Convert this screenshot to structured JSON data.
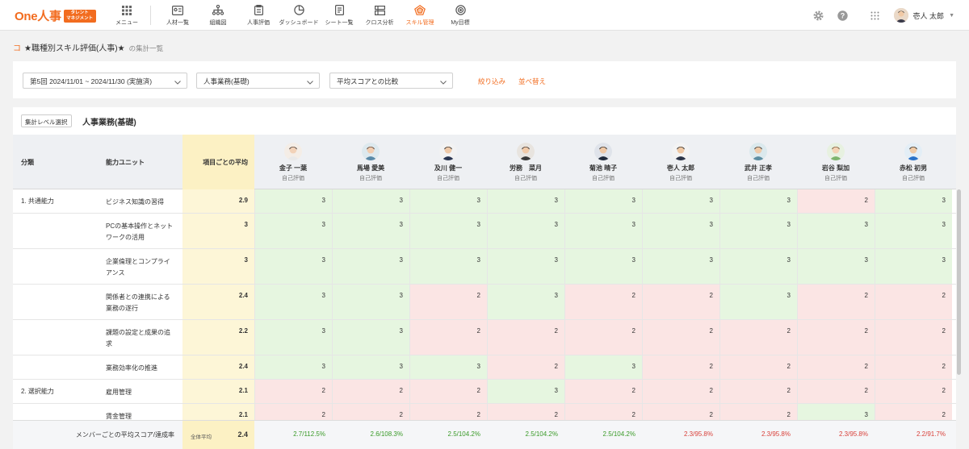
{
  "brand": {
    "logo": "One人事",
    "badge_line1": "タレント",
    "badge_line2": "マネジメント"
  },
  "nav": [
    {
      "label": "メニュー",
      "icon": "grid-menu-icon"
    },
    {
      "label": "人材一覧",
      "icon": "person-card-icon"
    },
    {
      "label": "組織図",
      "icon": "org-chart-icon"
    },
    {
      "label": "人事評価",
      "icon": "clipboard-icon"
    },
    {
      "label": "ダッシュボード",
      "icon": "pie-chart-icon"
    },
    {
      "label": "シート一覧",
      "icon": "document-icon"
    },
    {
      "label": "クロス分析",
      "icon": "cross-analysis-icon"
    },
    {
      "label": "スキル管理",
      "icon": "skill-radar-icon",
      "active": true
    },
    {
      "label": "My目標",
      "icon": "target-icon"
    }
  ],
  "user": {
    "name": "壱人 太郎"
  },
  "breadcrumb": {
    "back": "コ",
    "title": "★職種別スキル評価(人事)★",
    "sub": "の集計一覧"
  },
  "filters": {
    "period": "第5回 2024/11/01 ~ 2024/11/30 (実施済)",
    "job": "人事業務(基礎)",
    "compare": "平均スコアとの比較",
    "filter_link": "絞り込み",
    "sort_link": "並べ替え"
  },
  "level": {
    "button": "集計レベル選択",
    "name": "人事業務(基礎)"
  },
  "table": {
    "col_category": "分類",
    "col_unit": "能力ユニット",
    "col_avg": "項目ごとの平均",
    "members": [
      {
        "name": "金子 一葉",
        "type": "自己評価"
      },
      {
        "name": "馬場 愛美",
        "type": "自己評価"
      },
      {
        "name": "及川 健一",
        "type": "自己評価"
      },
      {
        "name": "労務　菜月",
        "type": "自己評価"
      },
      {
        "name": "菊池 晴子",
        "type": "自己評価"
      },
      {
        "name": "壱人 太郎",
        "type": "自己評価"
      },
      {
        "name": "武井 正孝",
        "type": "自己評価"
      },
      {
        "name": "岩谷 梨加",
        "type": "自己評価"
      },
      {
        "name": "赤松 初男",
        "type": "自己評価"
      }
    ],
    "rows": [
      {
        "category": "1. 共通能力",
        "unit": "ビジネス知識の習得",
        "avg": "2.9",
        "scores": [
          "3",
          "3",
          "3",
          "3",
          "3",
          "3",
          "3",
          "2",
          "3"
        ]
      },
      {
        "category": "",
        "unit": "PCの基本操作とネットワークの活用",
        "avg": "3",
        "scores": [
          "3",
          "3",
          "3",
          "3",
          "3",
          "3",
          "3",
          "3",
          "3"
        ]
      },
      {
        "category": "",
        "unit": "企業倫理とコンプライアンス",
        "avg": "3",
        "scores": [
          "3",
          "3",
          "3",
          "3",
          "3",
          "3",
          "3",
          "3",
          "3"
        ]
      },
      {
        "category": "",
        "unit": "関係者との連携による業務の遂行",
        "avg": "2.4",
        "scores": [
          "3",
          "3",
          "2",
          "3",
          "2",
          "2",
          "3",
          "2",
          "2"
        ]
      },
      {
        "category": "",
        "unit": "課題の設定と成果の追求",
        "avg": "2.2",
        "scores": [
          "3",
          "3",
          "2",
          "2",
          "2",
          "2",
          "2",
          "2",
          "2"
        ]
      },
      {
        "category": "",
        "unit": "業務効率化の推進",
        "avg": "2.4",
        "scores": [
          "3",
          "3",
          "3",
          "2",
          "3",
          "2",
          "2",
          "2",
          "2"
        ]
      },
      {
        "category": "2. 選択能力",
        "unit": "雇用管理",
        "avg": "2.1",
        "scores": [
          "2",
          "2",
          "2",
          "3",
          "2",
          "2",
          "2",
          "2",
          "2"
        ]
      },
      {
        "category": "",
        "unit": "賃金管理",
        "avg": "2.1",
        "scores": [
          "2",
          "2",
          "2",
          "2",
          "2",
          "2",
          "2",
          "3",
          "2"
        ]
      }
    ],
    "footer": {
      "label": "メンバーごとの平均スコア/達成率",
      "avg_label": "全体平均",
      "avg_value": "2.4",
      "values": [
        "2.7/112.5%",
        "2.6/108.3%",
        "2.5/104.2%",
        "2.5/104.2%",
        "2.5/104.2%",
        "2.3/95.8%",
        "2.3/95.8%",
        "2.3/95.8%",
        "2.2/91.7%"
      ]
    }
  },
  "colors": {
    "accent": "#f26c1f",
    "good": "#e6f6e0",
    "bad": "#fbe5e4",
    "avg_bg": "#fdf6d7"
  }
}
